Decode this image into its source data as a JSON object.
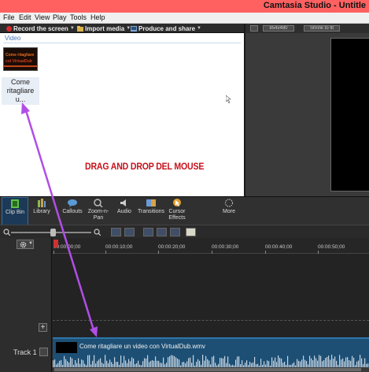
{
  "window": {
    "title": "Camtasia Studio - Untitle"
  },
  "menu": [
    "File",
    "Edit",
    "View",
    "Play",
    "Tools",
    "Help"
  ],
  "toolbar": {
    "record_label": "Record the screen",
    "import_label": "Import media",
    "produce_label": "Produce and share"
  },
  "clip_bin": {
    "section_label": "Video",
    "clip": {
      "thumb_line1": "Come ritagliare",
      "thumb_line2": "col VirtualDub",
      "label": "Come ritagliare u..."
    },
    "annotation": "DRAG AND DROP DEL MOUSE"
  },
  "preview": {
    "dimensions_label": "854x480",
    "fit_label": "Shrink to fit"
  },
  "tabs": [
    {
      "label": "Clip Bin",
      "icon": "film-icon",
      "active": true
    },
    {
      "label": "Library",
      "icon": "library-icon",
      "active": false
    },
    {
      "label": "Callouts",
      "icon": "callout-icon",
      "active": false
    },
    {
      "label": "Zoom-n-Pan",
      "icon": "zoom-pan-icon",
      "active": false
    },
    {
      "label": "Audio",
      "icon": "audio-icon",
      "active": false
    },
    {
      "label": "Transitions",
      "icon": "transitions-icon",
      "active": false
    },
    {
      "label": "Cursor Effects",
      "icon": "cursor-effects-icon",
      "active": false
    }
  ],
  "more_label": "More",
  "timeline": {
    "ruler_labels": [
      "00:00:00;00",
      "00:00:10;00",
      "00:00:20;00",
      "00:00:30;00",
      "00:00:40;00",
      "00:00:50;00"
    ],
    "track_label": "Track 1",
    "clip_title": "Come ritagliare un video con VirtualDub.wmv"
  },
  "colors": {
    "title_bar": "#ff6161",
    "annotation_red": "#c8101a",
    "arrow_purple": "#b14ee6",
    "clip_blue": "#1d4f74"
  }
}
